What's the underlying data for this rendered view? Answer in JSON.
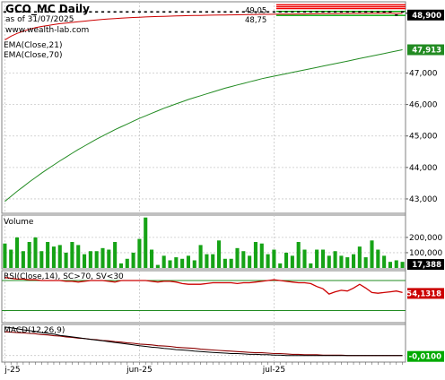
{
  "header": {
    "title": "GCO_MC Daily",
    "date_line": "as of 31/07/2025",
    "site": "www.wealth-lab.com"
  },
  "colors": {
    "price_bar": "#000000",
    "ema_short": "#cc0000",
    "ema_long": "#228b22",
    "volume": "#16a316",
    "volume_spike": "#16a316",
    "rsi": "#cc0000",
    "rsi_bands": "#228b22",
    "macd": "#000000",
    "macd_signal": "#8b0000",
    "hline_red": "#ee0000",
    "hline_green": "#00aa00",
    "last_value_box": "#000000",
    "ema_long_value_box": "#228b22",
    "rsi_value_box": "#cc0000",
    "macd_value_box": "#00aa00",
    "grid": "#c8c8c8"
  },
  "chart_data": [
    {
      "type": "line",
      "panel": "price",
      "title": "GCO_MC Daily",
      "x_ticks": [
        "j-25",
        "jun-25",
        "jul-25"
      ],
      "y_ticks": [
        "43,000",
        "44,000",
        "45,000",
        "46,000",
        "47,000"
      ],
      "ylim": [
        42600,
        49150
      ],
      "grid": true,
      "price_bars": {
        "name": "GCO_MC",
        "close": [
          48900,
          48900,
          48900,
          48900,
          48900,
          48900,
          48900,
          48900,
          48900,
          48900,
          48900,
          48900,
          48900,
          48900,
          48900,
          48900,
          48900,
          48900,
          48900,
          48900,
          48900,
          48900,
          48900,
          48900,
          48900,
          48900,
          48900,
          48900,
          48900,
          48900,
          48900,
          48900,
          48900,
          48900,
          48900,
          48900,
          48900,
          48900,
          48900,
          48900,
          48900,
          48900,
          48900,
          48900,
          48900,
          48900,
          48900,
          48900,
          48900,
          48900,
          48900,
          48900,
          48900,
          48900,
          48900,
          48900,
          48900,
          48900,
          48900,
          48900,
          48900,
          48900,
          48900,
          48900,
          48800,
          48900
        ]
      },
      "series": [
        {
          "name": "EMA(Close,21)",
          "values": [
            48050,
            48170,
            48260,
            48330,
            48390,
            48440,
            48480,
            48510,
            48540,
            48570,
            48590,
            48610,
            48630,
            48650,
            48670,
            48690,
            48705,
            48720,
            48732,
            48744,
            48755,
            48765,
            48774,
            48782,
            48790,
            48797,
            48803,
            48809,
            48814,
            48819,
            48824,
            48828,
            48832,
            48836,
            48840,
            48843,
            48846,
            48849,
            48852,
            48855,
            48858,
            48861,
            48864,
            48866,
            48868,
            48870,
            48872,
            48874,
            48876,
            48878,
            48880,
            48882,
            48884,
            48886,
            48888,
            48890,
            48892,
            48893,
            48894,
            48895,
            48896,
            48897,
            48898,
            48899,
            48895,
            48896
          ]
        },
        {
          "name": "EMA(Close,70)",
          "values": [
            42920,
            43080,
            43240,
            43390,
            43540,
            43680,
            43820,
            43950,
            44080,
            44210,
            44330,
            44450,
            44570,
            44680,
            44790,
            44900,
            45000,
            45100,
            45200,
            45290,
            45380,
            45470,
            45560,
            45640,
            45720,
            45800,
            45880,
            45950,
            46020,
            46090,
            46160,
            46220,
            46280,
            46340,
            46400,
            46460,
            46520,
            46570,
            46620,
            46670,
            46720,
            46770,
            46820,
            46860,
            46900,
            46940,
            46980,
            47020,
            47060,
            47100,
            47140,
            47180,
            47220,
            47260,
            47300,
            47340,
            47380,
            47420,
            47460,
            47500,
            47540,
            47580,
            47620,
            47660,
            47700,
            47740
          ]
        }
      ],
      "horizontal_lines": {
        "red": [
          49170,
          49110,
          49050
        ],
        "green": [
          48960,
          48830
        ]
      },
      "annotations": [
        "49,05",
        "48,75"
      ],
      "last_value": "48,900",
      "ema_long_last_value": "47,913"
    },
    {
      "type": "bar",
      "panel": "volume",
      "title": "Volume",
      "y_ticks": [
        "200,000",
        "100,000"
      ],
      "ylim": [
        0,
        340000
      ],
      "values": [
        160000,
        120000,
        200000,
        110000,
        170000,
        200000,
        110000,
        170000,
        140000,
        150000,
        100000,
        170000,
        150000,
        90000,
        110000,
        110000,
        130000,
        120000,
        170000,
        30000,
        60000,
        100000,
        190000,
        330000,
        120000,
        20000,
        80000,
        50000,
        70000,
        60000,
        80000,
        50000,
        150000,
        90000,
        90000,
        180000,
        60000,
        60000,
        130000,
        110000,
        80000,
        170000,
        160000,
        90000,
        120000,
        30000,
        100000,
        80000,
        170000,
        120000,
        30000,
        120000,
        120000,
        80000,
        110000,
        80000,
        70000,
        90000,
        140000,
        70000,
        180000,
        120000,
        80000,
        40000,
        50000,
        40000
      ],
      "last_value": "17,388"
    },
    {
      "type": "line",
      "panel": "rsi",
      "title": "RSI(Close,14), SC>70, SV<30",
      "y_ticks": [
        "30,000"
      ],
      "ylim": [
        15,
        82
      ],
      "bands": [
        70,
        30
      ],
      "series": [
        {
          "name": "RSI(Close,14)",
          "values": [
            74,
            73,
            72,
            72,
            71,
            71,
            70,
            70,
            70,
            70,
            69,
            69,
            68,
            69,
            70,
            70,
            70,
            69,
            68,
            70,
            70,
            70,
            70,
            70,
            69,
            68,
            69,
            69,
            68,
            66,
            65,
            65,
            65,
            66,
            67,
            67,
            67,
            67,
            66,
            67,
            67,
            68,
            69,
            70,
            71,
            70,
            69,
            68,
            67,
            67,
            66,
            62,
            59,
            52,
            55,
            57,
            56,
            60,
            65,
            60,
            54,
            53,
            54,
            55,
            56,
            54
          ]
        }
      ],
      "last_value": "54,1318"
    },
    {
      "type": "line",
      "panel": "macd",
      "title": "MACD(12,26,9)",
      "ylim": [
        -12,
        74
      ],
      "series": [
        {
          "name": "MACD(12,26,9)",
          "values": [
            72,
            70,
            68,
            65,
            63,
            61,
            58,
            56,
            54,
            51,
            49,
            47,
            45,
            43,
            41,
            39,
            37,
            35,
            33,
            31,
            29,
            27,
            25,
            23,
            21,
            20,
            18,
            17,
            15,
            14,
            13,
            11,
            10,
            9,
            8,
            7,
            6,
            5,
            5,
            4,
            3,
            3,
            2,
            2,
            1,
            1,
            0,
            0,
            0,
            0,
            0,
            0,
            0,
            0,
            0,
            0,
            0,
            0,
            0,
            0,
            0,
            0,
            0,
            0,
            0,
            0
          ]
        },
        {
          "name": "Signal",
          "values": [
            60,
            59,
            58,
            57,
            56,
            55,
            53,
            52,
            50,
            49,
            47,
            46,
            44,
            43,
            41,
            40,
            38,
            37,
            35,
            34,
            32,
            31,
            29,
            28,
            27,
            25,
            24,
            23,
            21,
            20,
            19,
            18,
            16,
            15,
            14,
            13,
            12,
            11,
            10,
            9,
            8,
            7,
            7,
            6,
            5,
            5,
            4,
            3,
            3,
            2,
            2,
            2,
            1,
            1,
            1,
            1,
            0,
            0,
            0,
            0,
            0,
            0,
            0,
            0,
            0,
            0
          ]
        }
      ],
      "last_value": "-0,0100"
    }
  ]
}
